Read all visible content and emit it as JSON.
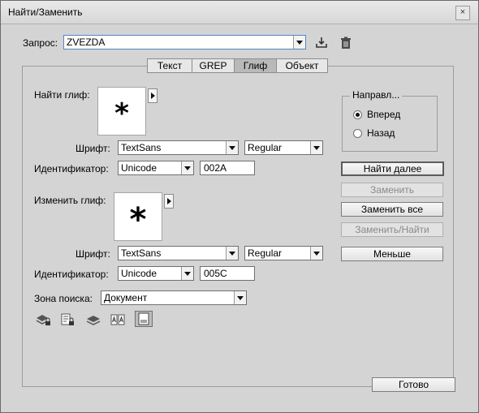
{
  "window": {
    "title": "Найти/Заменить",
    "close_glyph": "×"
  },
  "query": {
    "label": "Запрос:",
    "value": "ZVEZDA"
  },
  "tabs": [
    {
      "label": "Текст",
      "active": false
    },
    {
      "label": "GREP",
      "active": false
    },
    {
      "label": "Глиф",
      "active": true
    },
    {
      "label": "Объект",
      "active": false
    }
  ],
  "find_glyph": {
    "label": "Найти глиф:",
    "glyph": "*",
    "font_label": "Шрифт:",
    "font": "TextSans",
    "style": "Regular",
    "id_label": "Идентификатор:",
    "id_type": "Unicode",
    "id_value": "002A"
  },
  "change_glyph": {
    "label": "Изменить глиф:",
    "glyph": "*",
    "font_label": "Шрифт:",
    "font": "TextSans",
    "style": "Regular",
    "id_label": "Идентификатор:",
    "id_type": "Unicode",
    "id_value": "005C"
  },
  "direction": {
    "title": "Направл...",
    "options": [
      {
        "label": "Вперед",
        "checked": true
      },
      {
        "label": "Назад",
        "checked": false
      }
    ]
  },
  "buttons": {
    "find_next": "Найти далее",
    "replace": "Заменить",
    "replace_all": "Заменить все",
    "replace_find": "Заменить/Найти",
    "fewer": "Меньше",
    "done": "Готово"
  },
  "search": {
    "label": "Зона поиска:",
    "value": "Документ"
  },
  "option_icons": [
    "include-locked-layers-icon",
    "include-locked-stories-icon",
    "include-hidden-layers-icon",
    "include-master-pages-icon",
    "include-footnotes-icon"
  ]
}
